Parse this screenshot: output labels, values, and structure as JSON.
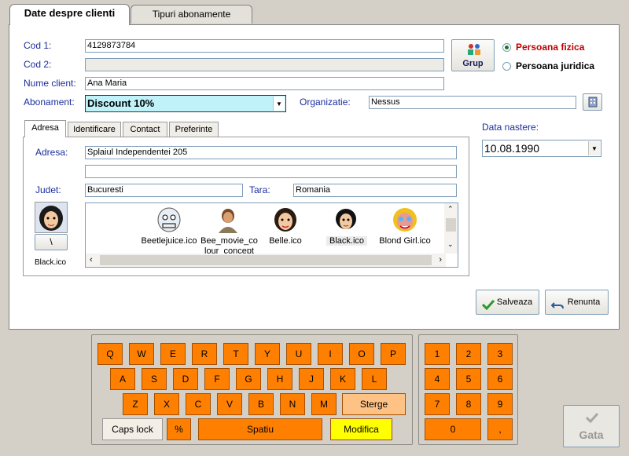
{
  "tabs": [
    "Date despre clienti",
    "Tipuri abonamente"
  ],
  "form": {
    "cod1_label": "Cod 1:",
    "cod1_value": "4129873784",
    "cod2_label": "Cod 2:",
    "cod2_value": "",
    "nume_label": "Nume client:",
    "nume_value": "Ana Maria",
    "abonament_label": "Abonament:",
    "abonament_value": "Discount 10%",
    "organizatie_label": "Organizatie:",
    "organizatie_value": "Nessus",
    "grup_label": "Grup",
    "persoana_fizica": "Persoana fizica",
    "persoana_juridica": "Persoana juridica",
    "data_label": "Data nastere:",
    "data_value": "10.08.1990"
  },
  "subtabs": [
    "Adresa",
    "Identificare",
    "Contact",
    "Preferinte"
  ],
  "address": {
    "adresa_label": "Adresa:",
    "adresa_value": "Splaiul Independentei 205",
    "adresa2_value": "",
    "judet_label": "Judet:",
    "judet_value": "Bucuresti",
    "tara_label": "Tara:",
    "tara_value": "Romania"
  },
  "avatar": {
    "label": "Black.ico",
    "button": "\\"
  },
  "icons": [
    {
      "label": "Beetlejuice.ico",
      "icon": "beetlejuice-icon"
    },
    {
      "label": "Bee_movie_co lour_concept",
      "icon": "bee-movie-icon"
    },
    {
      "label": "Belle.ico",
      "icon": "belle-icon"
    },
    {
      "label": "Black.ico",
      "icon": "black-icon"
    },
    {
      "label": "Blond Girl.ico",
      "icon": "blond-girl-icon"
    }
  ],
  "actions": {
    "save": "Salveaza",
    "cancel": "Renunta",
    "done": "Gata"
  },
  "keyboard": {
    "row1": [
      "Q",
      "W",
      "E",
      "R",
      "T",
      "Y",
      "U",
      "I",
      "O",
      "P"
    ],
    "row2": [
      "A",
      "S",
      "D",
      "F",
      "G",
      "H",
      "J",
      "K",
      "L"
    ],
    "row3": [
      "Z",
      "X",
      "C",
      "V",
      "B",
      "N",
      "M"
    ],
    "sterge": "Sterge",
    "caps": "Caps lock",
    "percent": "%",
    "space": "Spatiu",
    "modifica": "Modifica",
    "numpad": [
      "1",
      "2",
      "3",
      "4",
      "5",
      "6",
      "7",
      "8",
      "9",
      "0",
      ","
    ]
  },
  "colors": {
    "accent": "#ff8000",
    "label_blue": "#1c2d9c",
    "highlight": "#bff2f9",
    "radio_red": "#c00000"
  }
}
